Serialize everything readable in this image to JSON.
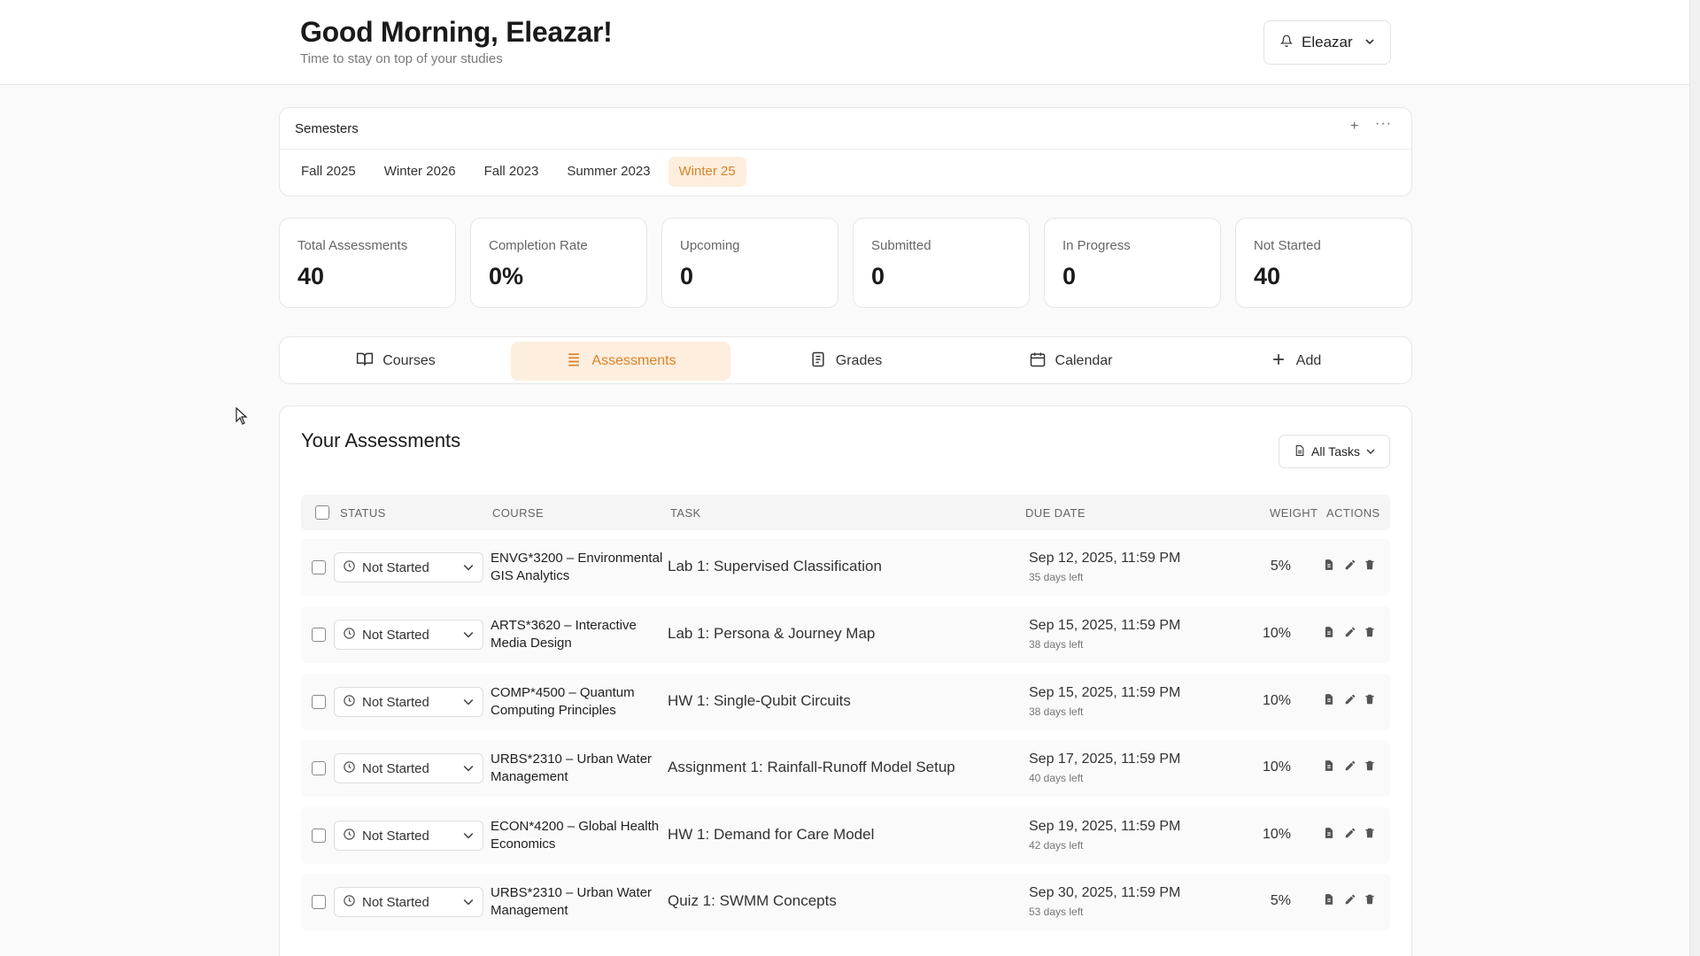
{
  "header": {
    "greeting": "Good Morning, Eleazar!",
    "subtitle": "Time to stay on top of your studies",
    "user_name": "Eleazar"
  },
  "semesters": {
    "title": "Semesters",
    "add_label": "+",
    "more_label": "···",
    "tabs": [
      "Fall 2025",
      "Winter 2026",
      "Fall 2023",
      "Summer 2023",
      "Winter 25"
    ],
    "active_tab": "Winter 25"
  },
  "stats": [
    {
      "label": "Total Assessments",
      "value": "40"
    },
    {
      "label": "Completion Rate",
      "value": "0%"
    },
    {
      "label": "Upcoming",
      "value": "0"
    },
    {
      "label": "Submitted",
      "value": "0"
    },
    {
      "label": "In Progress",
      "value": "0"
    },
    {
      "label": "Not Started",
      "value": "40"
    }
  ],
  "nav": {
    "items": [
      {
        "label": "Courses",
        "icon": "book-icon"
      },
      {
        "label": "Assessments",
        "icon": "list-icon"
      },
      {
        "label": "Grades",
        "icon": "report-icon"
      },
      {
        "label": "Calendar",
        "icon": "calendar-icon"
      },
      {
        "label": "Add",
        "icon": "plus-icon"
      }
    ],
    "active": "Assessments"
  },
  "assessments": {
    "title": "Your Assessments",
    "filter_label": "All Tasks",
    "columns": {
      "status": "STATUS",
      "course": "COURSE",
      "task": "TASK",
      "due": "DUE DATE",
      "weight": "WEIGHT",
      "actions": "ACTIONS"
    },
    "rows": [
      {
        "status": "Not Started",
        "course": "ENVG*3200 – Environmental GIS Analytics",
        "task": "Lab 1: Supervised Classification",
        "due": "Sep 12, 2025, 11:59 PM",
        "left": "35 days left",
        "weight": "5%"
      },
      {
        "status": "Not Started",
        "course": "ARTS*3620 – Interactive Media Design",
        "task": "Lab 1: Persona & Journey Map",
        "due": "Sep 15, 2025, 11:59 PM",
        "left": "38 days left",
        "weight": "10%"
      },
      {
        "status": "Not Started",
        "course": "COMP*4500 – Quantum Computing Principles",
        "task": "HW 1: Single-Qubit Circuits",
        "due": "Sep 15, 2025, 11:59 PM",
        "left": "38 days left",
        "weight": "10%"
      },
      {
        "status": "Not Started",
        "course": "URBS*2310 – Urban Water Management",
        "task": "Assignment 1: Rainfall-Runoff Model Setup",
        "due": "Sep 17, 2025, 11:59 PM",
        "left": "40 days left",
        "weight": "10%"
      },
      {
        "status": "Not Started",
        "course": "ECON*4200 – Global Health Economics",
        "task": "HW 1: Demand for Care Model",
        "due": "Sep 19, 2025, 11:59 PM",
        "left": "42 days left",
        "weight": "10%"
      },
      {
        "status": "Not Started",
        "course": "URBS*2310 – Urban Water Management",
        "task": "Quiz 1: SWMM Concepts",
        "due": "Sep 30, 2025, 11:59 PM",
        "left": "53 days left",
        "weight": "5%"
      }
    ]
  },
  "colors": {
    "accent": "#d9822b",
    "accent_bg": "#fdeedd"
  }
}
